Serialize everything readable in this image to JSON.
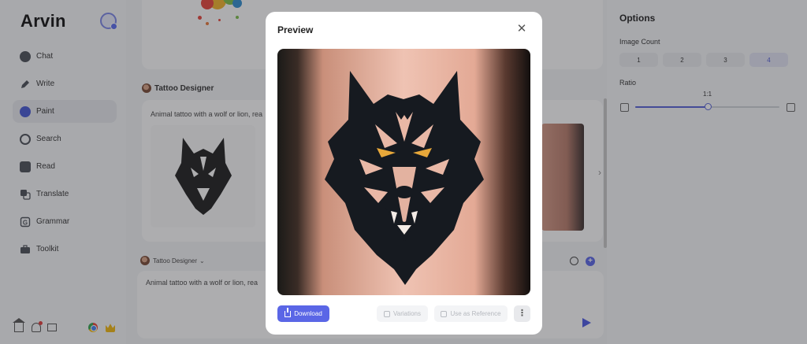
{
  "sidebar": {
    "brand": "Arvin",
    "nav": [
      {
        "label": "Chat",
        "icon": "chat-icon",
        "active": false
      },
      {
        "label": "Write",
        "icon": "pen-icon",
        "active": false
      },
      {
        "label": "Paint",
        "icon": "paint-icon",
        "active": true
      },
      {
        "label": "Search",
        "icon": "search-icon",
        "active": false
      },
      {
        "label": "Read",
        "icon": "book-icon",
        "active": false
      },
      {
        "label": "Translate",
        "icon": "translate-icon",
        "active": false
      },
      {
        "label": "Grammar",
        "icon": "grammar-icon",
        "active": false
      },
      {
        "label": "Toolkit",
        "icon": "toolkit-icon",
        "active": false
      }
    ],
    "bottom_icons": [
      "home-icon",
      "bell-icon",
      "mail-icon",
      "chrome-icon",
      "crown-icon"
    ]
  },
  "chat": {
    "assistant_name": "Tattoo Designer",
    "prompt": "Animal tattoo with a wolf or lion, rea",
    "composer": {
      "assistant_name": "Tattoo Designer",
      "prompt": "Animal tattoo with a wolf or lion, rea"
    }
  },
  "options": {
    "title": "Options",
    "image_count_label": "Image Count",
    "image_counts": [
      "1",
      "2",
      "3",
      "4"
    ],
    "selected_count": "4",
    "ratio_label": "Ratio",
    "ratio_value": "1:1",
    "ratio_slider_fraction": 0.5
  },
  "modal": {
    "title": "Preview",
    "close_icon": "close-icon",
    "download_label": "Download",
    "variations_label": "Variations",
    "use_as_reference_label": "Use as Reference",
    "more_icon": "more-vertical-icon"
  },
  "colors": {
    "accent": "#5a66e6",
    "overlay": "rgba(40,40,44,0.38)"
  }
}
